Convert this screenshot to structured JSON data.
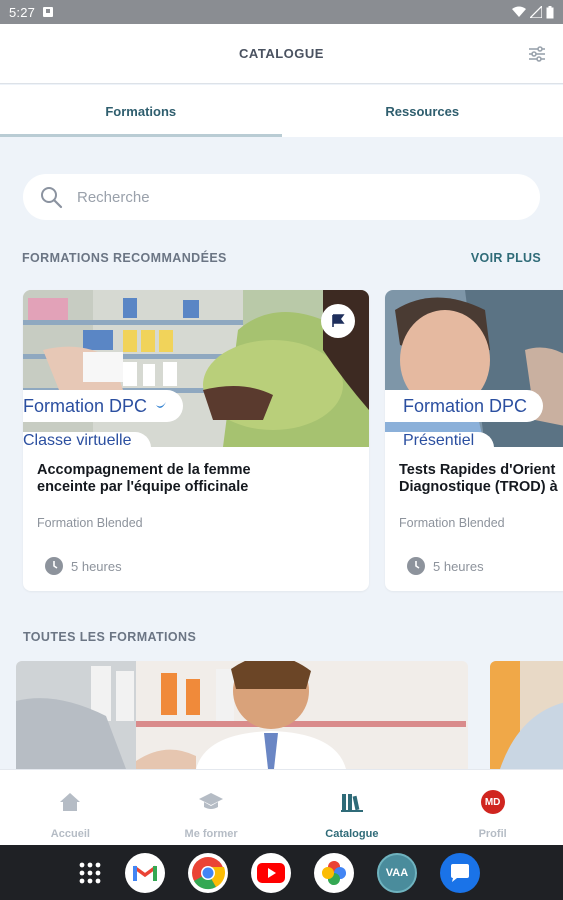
{
  "status": {
    "time": "5:27"
  },
  "header": {
    "title": "CATALOGUE"
  },
  "tabs": [
    {
      "label": "Formations",
      "active": true
    },
    {
      "label": "Ressources",
      "active": false
    }
  ],
  "search": {
    "placeholder": "Recherche"
  },
  "recommended": {
    "title": "FORMATIONS RECOMMANDÉES",
    "more_label": "VOIR PLUS",
    "cards": [
      {
        "badge": "Formation DPC",
        "badge2": "Classe virtuelle",
        "title_line1": "Accompagnement de la femme",
        "title_line2": "enceinte par l'équipe officinale",
        "type": "Formation Blended",
        "duration": "5 heures"
      },
      {
        "badge": "Formation DPC",
        "badge2": "Présentiel",
        "title_line1": "Tests Rapides d'Orient",
        "title_line2": "Diagnostique (TROD) à",
        "type": "Formation Blended",
        "duration": "5 heures"
      }
    ]
  },
  "all": {
    "title": "TOUTES LES FORMATIONS"
  },
  "bottom_nav": [
    {
      "label": "Accueil",
      "icon": "home-icon"
    },
    {
      "label": "Me former",
      "icon": "graduation-cap-icon"
    },
    {
      "label": "Catalogue",
      "icon": "books-icon",
      "active": true
    },
    {
      "label": "Profil",
      "icon": "avatar-md-icon",
      "avatar_text": "MD"
    }
  ],
  "system_apps": [
    {
      "name": "app-grid-icon"
    },
    {
      "name": "gmail-icon"
    },
    {
      "name": "chrome-icon"
    },
    {
      "name": "youtube-icon"
    },
    {
      "name": "photos-icon"
    },
    {
      "name": "vaa-icon",
      "label": "VAA"
    },
    {
      "name": "messages-icon"
    }
  ],
  "colors": {
    "accent": "#2f6b78",
    "badge_text": "#2b4fa0",
    "profile_red": "#d0251f"
  }
}
